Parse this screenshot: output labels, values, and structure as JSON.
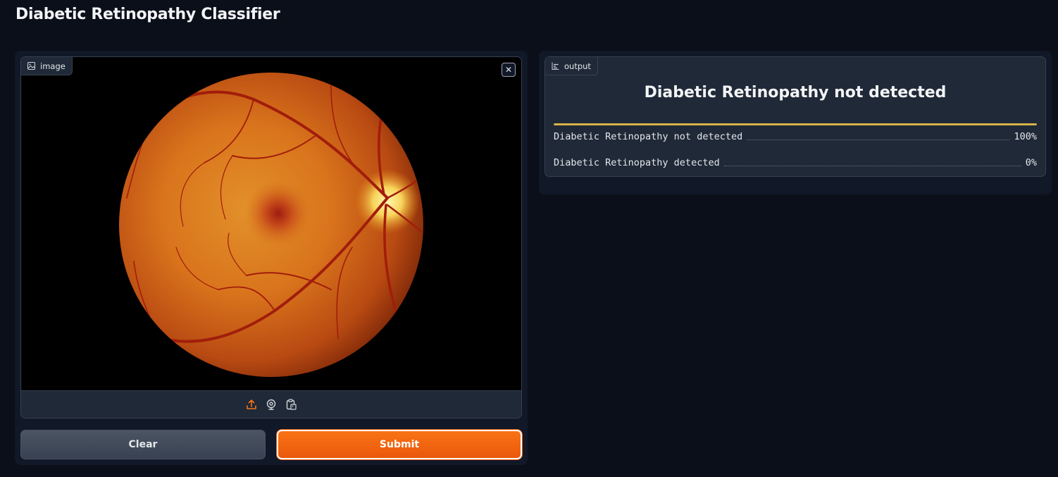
{
  "page": {
    "title": "Diabetic Retinopathy Classifier"
  },
  "input": {
    "label": "image",
    "label_icon": "image-icon",
    "close_icon": "close-icon",
    "image_content": "fundus retina photograph",
    "sources": [
      {
        "name": "upload",
        "icon": "upload-icon",
        "active": true
      },
      {
        "name": "webcam",
        "icon": "webcam-icon",
        "active": false
      },
      {
        "name": "clipboard",
        "icon": "clipboard-icon",
        "active": false
      }
    ]
  },
  "buttons": {
    "clear_label": "Clear",
    "submit_label": "Submit"
  },
  "output": {
    "label": "output",
    "label_icon": "bar-chart-icon",
    "top_label": "Diabetic Retinopathy not detected",
    "confidences": [
      {
        "label": "Diabetic Retinopathy not detected",
        "value": "100%",
        "fraction": 1.0
      },
      {
        "label": "Diabetic Retinopathy detected",
        "value": "0%",
        "fraction": 0.0
      }
    ]
  },
  "colors": {
    "background": "#0b0f19",
    "panel": "#1f2937",
    "accent": "#f97316",
    "confidence_bar": "#d7b349"
  }
}
